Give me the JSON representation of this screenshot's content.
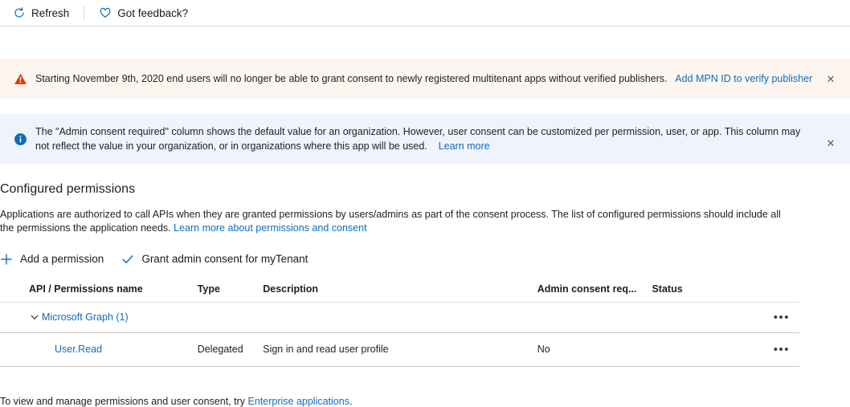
{
  "toolbar": {
    "refresh": {
      "label": "Refresh",
      "icon": "refresh-icon"
    },
    "feedback": {
      "label": "Got feedback?",
      "icon": "heart-icon"
    }
  },
  "banners": {
    "warning": {
      "icon": "warning-icon",
      "accent": "#d83b01",
      "background": "#fdf6f0",
      "text": "Starting November 9th, 2020 end users will no longer be able to grant consent to newly registered multitenant apps without verified publishers.",
      "link": "Add MPN ID to verify publisher",
      "close_label": "✕"
    },
    "info": {
      "icon": "info-icon",
      "accent": "#0f6cbd",
      "background": "#eef3fc",
      "text": "The \"Admin consent required\" column shows the default value for an organization. However, user consent can be customized per permission, user, or app. This column may not reflect the value in your organization, or in organizations where this app will be used.",
      "link": "Learn more",
      "close_label": "✕"
    }
  },
  "section": {
    "title": "Configured permissions",
    "description": "Applications are authorized to call APIs when they are granted permissions by users/admins as part of the consent process. The list of configured permissions should include all the permissions the application needs.",
    "description_link": "Learn more about permissions and consent"
  },
  "actions": [
    {
      "label": "Add a permission",
      "icon": "plus-icon",
      "name": "add-permission-button"
    },
    {
      "label": "Grant admin consent for myTenant",
      "icon": "checkmark-icon",
      "name": "grant-admin-consent-button"
    }
  ],
  "table": {
    "headers": [
      "API / Permissions name",
      "Type",
      "Description",
      "Admin consent req...",
      "Status",
      ""
    ],
    "groups": [
      {
        "name": "Microsoft Graph (1)",
        "expanded": true,
        "chevron": "chevron-down-icon",
        "menu": "•••",
        "rows": [
          {
            "name": "User.Read",
            "type": "Delegated",
            "description": "Sign in and read user profile",
            "admin_consent_required": "No",
            "status": "",
            "menu": "•••"
          }
        ]
      }
    ]
  },
  "footer": {
    "text_before": "To view and manage permissions and user consent, try ",
    "link": "Enterprise applications",
    "text_after": "."
  }
}
